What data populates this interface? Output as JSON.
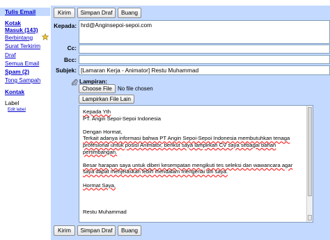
{
  "sidebar": {
    "compose": "Tulis Email",
    "inbox_line1": "Kotak",
    "inbox_line2": "Masuk (143)",
    "starred": "Berbintang",
    "sent": "Surat Terkirim",
    "drafts": "Draf",
    "all_mail": "Semua Email",
    "spam": "Spam (2)",
    "trash": "Tong Sampah",
    "contacts": "Kontak",
    "labels_heading": "Label",
    "edit_labels": "Edit label"
  },
  "toolbar": {
    "send": "Kirim",
    "save_draft": "Simpan Draf",
    "discard": "Buang"
  },
  "fields": {
    "to_label": "Kepada:",
    "to_value": "hrd@Anginsepoi-sepoi.com",
    "cc_label": "Cc:",
    "cc_value": "",
    "bcc_label": "Bcc:",
    "bcc_value": "",
    "subject_label": "Subjek:",
    "subject_value": "[Lamaran Kerja - Animator] Restu Muhammad"
  },
  "attachments": {
    "label": "Lampiran:",
    "choose_file": "Choose File",
    "no_file": "No file chosen",
    "attach_another": "Lampirkan File Lain"
  },
  "body": {
    "line1": "Kepada Yth",
    "line2": "PT. Angin Sepoi-Sepoi Indonesia",
    "line3": "Dengan Hormat,",
    "line4": "Terkait adanya informasi bahwa PT Angin Sepoi-Sepoi Indonesia membutuhkan tenaga",
    "line5": "profesional untuk posisi Animator, berikut saya lampirkan CV saya sebagai bahan",
    "line6": "pertimbangan.",
    "line7": "Besar harapan saya untuk diberi kesempatan mengikuti tes seleksi dan wawancara agar",
    "line8": "saya dapat menjelaskan lebih mendalam mengenai diri saya.",
    "line9": "Hormat Saya,",
    "line10": "Restu Muhammad"
  },
  "icons": {
    "star": "star-icon",
    "attachment": "paperclip-icon"
  },
  "colors": {
    "panel": "#c3d9ff",
    "link": "#0000cc",
    "star": "#f6c531"
  }
}
